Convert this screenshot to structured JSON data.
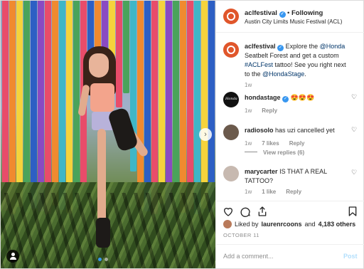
{
  "header": {
    "username": "aclfestival",
    "separator": "•",
    "follow_status": "Following",
    "subtitle": "Austin City Limits Music Festival (ACL)"
  },
  "caption": {
    "username": "aclfestival",
    "text_1": "Explore the ",
    "link_1": "@Honda",
    "text_2": " Seatbelt Forest and get a custom ",
    "link_2": "#ACLFest",
    "text_3": " tattoo! See you right next to the ",
    "link_3": "@HondaStage",
    "text_4": ".",
    "time": "1w"
  },
  "comments": [
    {
      "username": "hondastage",
      "text": "😍😍😍",
      "time": "1w",
      "likes": "",
      "reply": "Reply",
      "avatar_color": "#111111"
    },
    {
      "username": "radiosolo",
      "text": "has uzi cancelled yet",
      "time": "1w",
      "likes": "7 likes",
      "reply": "Reply",
      "view_replies": "View replies (6)",
      "avatar_color": "#6b5a4c"
    },
    {
      "username": "marycarter",
      "text": "IS THAT A REAL TATTOO?",
      "time": "1w",
      "likes": "1 like",
      "reply": "Reply",
      "avatar_color": "#c7b9b0"
    }
  ],
  "likes": {
    "prefix": "Liked by",
    "user": "laurenrcoons",
    "middle": "and",
    "count": "4,183 others"
  },
  "date": "OCTOBER 11",
  "add_comment": {
    "placeholder": "Add a comment...",
    "post_label": "Post"
  },
  "carousel": {
    "count": 2,
    "active_index": 0
  },
  "colors": {
    "accent": "#3897f0",
    "brand_avatar": "#e0562b",
    "link": "#003569"
  },
  "icons": [
    "heart-icon",
    "comment-icon",
    "share-icon",
    "bookmark-icon",
    "verified-icon",
    "chevron-right-icon",
    "user-tag-icon"
  ]
}
